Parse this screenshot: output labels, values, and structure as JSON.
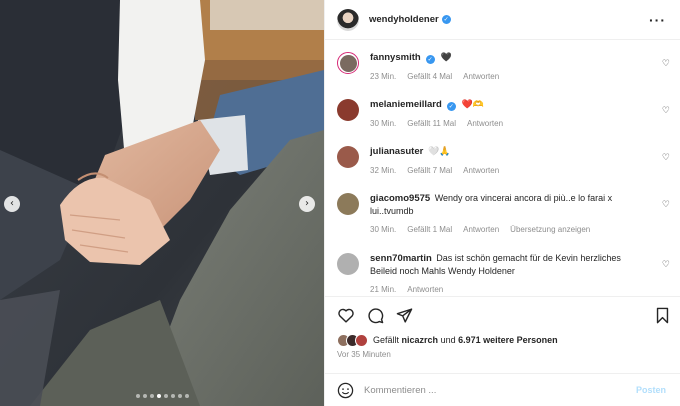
{
  "post": {
    "author": {
      "username": "wendyholdener",
      "verified": true
    },
    "carousel": {
      "dot_count": 8,
      "active_index": 3,
      "prev_glyph": "‹",
      "next_glyph": "›"
    }
  },
  "comments": [
    {
      "username": "fannysmith",
      "verified": true,
      "text": "",
      "emoji": "🖤",
      "time": "23 Min.",
      "likes": "Gefällt 4 Mal",
      "reply": "Antworten",
      "extra": "",
      "avatar_color": "#7a6a60",
      "story_ring": true
    },
    {
      "username": "melaniemeillard",
      "verified": true,
      "text": "",
      "emoji": "❤️🫶",
      "time": "30 Min.",
      "likes": "Gefällt 11 Mal",
      "reply": "Antworten",
      "extra": "",
      "avatar_color": "#8a3a2e",
      "story_ring": false
    },
    {
      "username": "julianasuter",
      "verified": false,
      "text": "",
      "emoji": "🤍🙏",
      "time": "32 Min.",
      "likes": "Gefällt 7 Mal",
      "reply": "Antworten",
      "extra": "",
      "avatar_color": "#9a5a4a",
      "story_ring": false
    },
    {
      "username": "giacomo9575",
      "verified": false,
      "text": "Wendy ora vincerai ancora di più..e lo farai x lui..tvumdb",
      "emoji": "",
      "time": "30 Min.",
      "likes": "Gefällt 1 Mal",
      "reply": "Antworten",
      "extra": "Übersetzung anzeigen",
      "avatar_color": "#8c7a5a",
      "story_ring": false
    },
    {
      "username": "senn70martin",
      "verified": false,
      "text": "Das ist schön gemacht für de Kevin herzliches Beileid noch Mahls Wendy Holdener",
      "emoji": "",
      "time": "21 Min.",
      "likes": "",
      "reply": "Antworten",
      "extra": "",
      "avatar_color": "#b0b0b0",
      "story_ring": false
    }
  ],
  "actions": {
    "like_icon": "heart-outline-icon",
    "comment_icon": "comment-bubble-icon",
    "share_icon": "paper-plane-icon",
    "save_icon": "bookmark-icon"
  },
  "likes": {
    "prefix": "Gefällt",
    "user": "nicazrch",
    "middle": "und",
    "others": "6.971 weitere Personen"
  },
  "timestamp": "Vor 35 Minuten",
  "comment_box": {
    "placeholder": "Kommentieren ...",
    "post_label": "Posten",
    "emoji_icon": "smiley-icon"
  },
  "colors": {
    "verified": "#3897f0",
    "meta_text": "#8e8e8e",
    "post_disabled": "#b2dffc",
    "story_ring": "#d62976"
  }
}
